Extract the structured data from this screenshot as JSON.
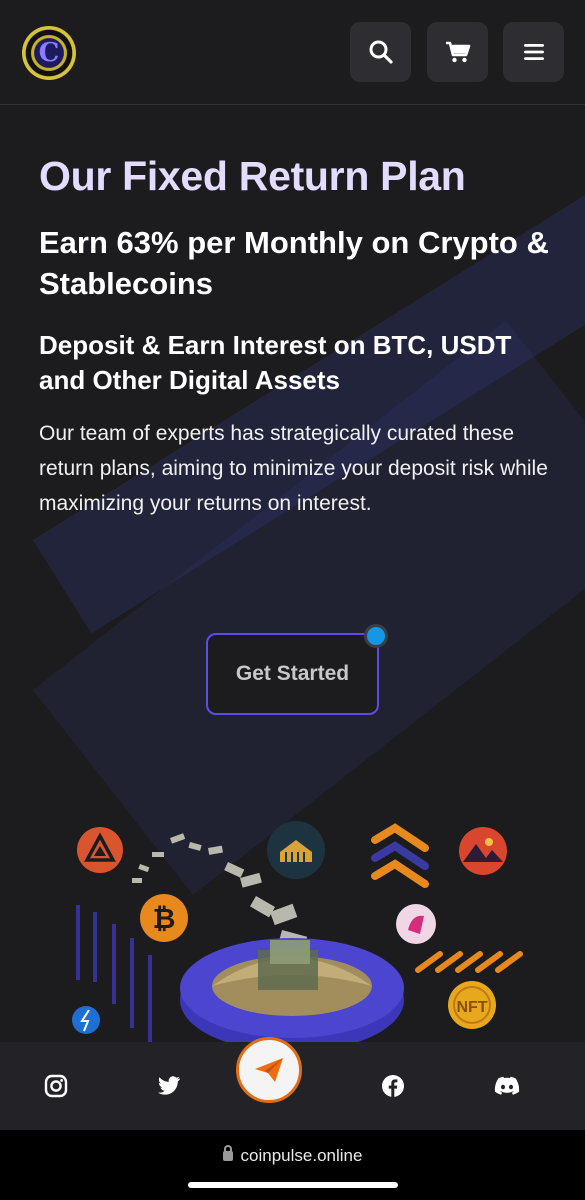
{
  "header": {
    "logo_letter": "C",
    "buttons": [
      {
        "name": "search",
        "icon": "search-icon"
      },
      {
        "name": "cart",
        "icon": "cart-icon"
      },
      {
        "name": "menu",
        "icon": "hamburger-menu-icon"
      }
    ]
  },
  "hero": {
    "title": "Our Fixed Return Plan",
    "subtitle": "Earn 63% per Monthly on Crypto & Stablecoins",
    "subheading": "Deposit & Earn Interest on BTC, USDT and Other Digital Assets",
    "description": "Our team of experts has strategically curated these return plans, aiming to minimize your deposit risk while maximizing your returns on interest.",
    "cta_label": "Get Started"
  },
  "illustration": {
    "icons": [
      "triangle-token-icon",
      "bitcoin-icon",
      "house-token-icon",
      "layers-token-icon",
      "unicorn-token-icon",
      "landscape-nft-icon",
      "nft-coin-icon",
      "flash-token-icon"
    ],
    "nft_label": "NFT",
    "btc_symbol": "₿"
  },
  "social": {
    "icons": [
      "instagram-icon",
      "twitter-icon",
      "telegram-send-icon",
      "facebook-icon",
      "discord-icon"
    ]
  },
  "browser": {
    "url": "coinpulse.online"
  },
  "colors": {
    "background": "#1c1c1f",
    "title": "#e4dcff",
    "cta_border": "#5c4de3",
    "accent_orange": "#e06d17",
    "accent_blue": "#1597e5"
  }
}
